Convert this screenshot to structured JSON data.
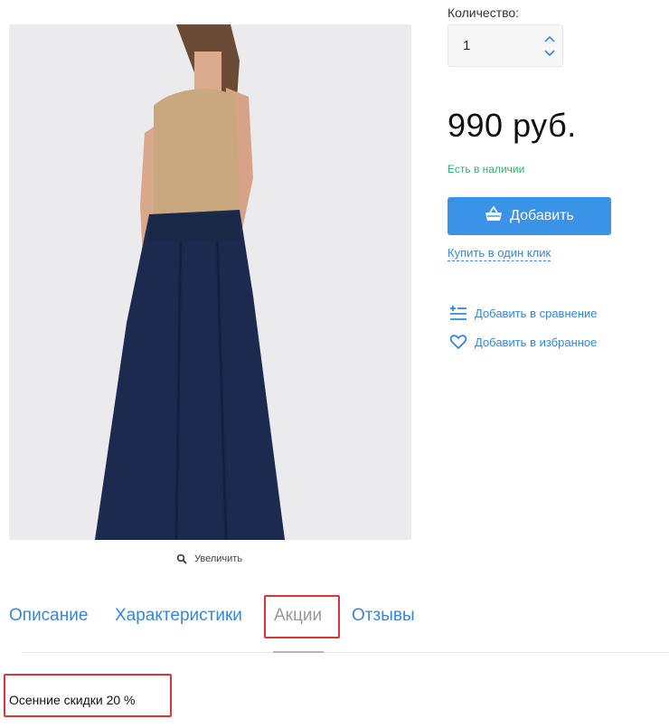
{
  "product_image": {
    "alt": "product photo"
  },
  "zoom": {
    "label": "Увеличить"
  },
  "quantity": {
    "label": "Количество:",
    "value": "1"
  },
  "price": "990 руб.",
  "stock": "Есть в наличии",
  "add_button": {
    "label": "Добавить"
  },
  "one_click": "Купить в один клик",
  "actions": {
    "compare": "Добавить в сравнение",
    "favorite": "Добавить в избранное"
  },
  "tabs": [
    {
      "label": "Описание",
      "active": false
    },
    {
      "label": "Характеристики",
      "active": false
    },
    {
      "label": "Акции",
      "active": true
    },
    {
      "label": "Отзывы",
      "active": false
    }
  ],
  "tab_content": {
    "text": "Осенние скидки 20 %"
  },
  "colors": {
    "accent": "#3a93e6",
    "link": "#3a86d6",
    "in_stock": "#2bb36a",
    "highlight": "#d9343a"
  },
  "icons": {
    "zoom": "search-icon",
    "add": "basket-icon",
    "compare": "compare-icon",
    "favorite": "heart-icon",
    "qty_up": "chevron-up-icon",
    "qty_down": "chevron-down-icon"
  }
}
